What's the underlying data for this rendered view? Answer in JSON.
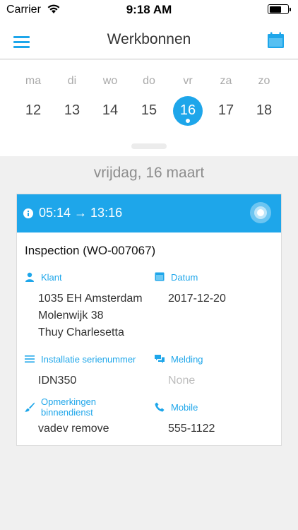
{
  "status_bar": {
    "carrier": "Carrier",
    "time": "9:18 AM",
    "battery_level": 0.7
  },
  "nav": {
    "title": "Werkbonnen",
    "menu_icon": "menu-icon",
    "calendar_icon": "calendar-icon"
  },
  "week": {
    "days": [
      {
        "name": "ma",
        "num": "12"
      },
      {
        "name": "di",
        "num": "13"
      },
      {
        "name": "wo",
        "num": "14"
      },
      {
        "name": "do",
        "num": "15"
      },
      {
        "name": "vr",
        "num": "16"
      },
      {
        "name": "za",
        "num": "17"
      },
      {
        "name": "zo",
        "num": "18"
      }
    ],
    "selected_index": 4
  },
  "date_heading": "vrijdag, 16 maart",
  "work_order": {
    "time_range": "05:14 → 13:16",
    "title": "Inspection (WO-007067)",
    "accent_color": "#1ea6ea",
    "fields": {
      "klant": {
        "label": "Klant",
        "icon": "person-icon",
        "lines": [
          "1035 EH Amsterdam",
          "Molenwijk 38",
          "Thuy Charlesetta"
        ]
      },
      "datum": {
        "label": "Datum",
        "icon": "calendar-icon",
        "value": "2017-12-20"
      },
      "installatie": {
        "label": "Installatie serienummer",
        "icon": "list-icon",
        "value": "IDN350"
      },
      "melding": {
        "label": "Melding",
        "icon": "chat-icon",
        "value": "None"
      },
      "opmerkingen": {
        "label_line1": "Opmerkingen",
        "label_line2": "binnendienst",
        "icon": "brush-icon",
        "value": "vadev remove"
      },
      "mobile": {
        "label": "Mobile",
        "icon": "phone-icon",
        "value": "555-1122"
      }
    }
  }
}
